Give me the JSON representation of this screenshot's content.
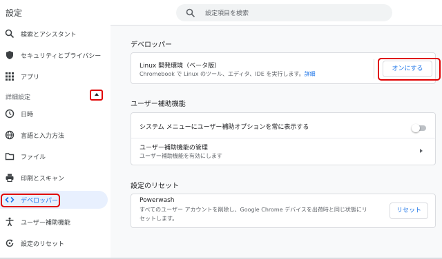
{
  "app": {
    "title": "設定"
  },
  "search": {
    "placeholder": "設定項目を検索"
  },
  "sidebar": {
    "items": [
      {
        "label": "検索とアシスタント",
        "icon": "search-icon"
      },
      {
        "label": "セキュリティとプライバシー",
        "icon": "shield-icon"
      },
      {
        "label": "アプリ",
        "icon": "apps-grid-icon"
      }
    ],
    "advanced_header": "詳細設定",
    "advanced_items": [
      {
        "label": "日時",
        "icon": "clock-icon"
      },
      {
        "label": "言語と入力方法",
        "icon": "globe-icon"
      },
      {
        "label": "ファイル",
        "icon": "folder-icon"
      },
      {
        "label": "印刷とスキャン",
        "icon": "printer-icon"
      },
      {
        "label": "デベロッパー",
        "icon": "code-icon",
        "active": true
      },
      {
        "label": "ユーザー補助機能",
        "icon": "accessibility-icon"
      },
      {
        "label": "設定のリセット",
        "icon": "reset-icon"
      }
    ]
  },
  "developer": {
    "title": "デベロッパー",
    "linux_title": "Linux 開発環境（ベータ版）",
    "linux_desc": "Chromebook で Linux のツール、エディタ、IDE を実行します。",
    "linux_link": "詳細",
    "turn_on_label": "オンにする"
  },
  "accessibility": {
    "title": "ユーザー補助機能",
    "show_menu_label": "システム メニューにユーザー補助オプションを常に表示する",
    "show_menu_enabled": false,
    "manage_title": "ユーザー補助機能の管理",
    "manage_sub": "ユーザー補助機能を有効にします"
  },
  "reset": {
    "title": "設定のリセット",
    "powerwash_title": "Powerwash",
    "powerwash_desc_line1": "すべてのユーザー アカウントを削除し、Google Chrome デバイスを出荷時と同じ状態にリ",
    "powerwash_desc_line2": "セットします。",
    "reset_button": "リセット"
  },
  "colors": {
    "accent": "#1a73e8",
    "annotation": "#e00000",
    "active_bg": "#e8f0fe"
  }
}
